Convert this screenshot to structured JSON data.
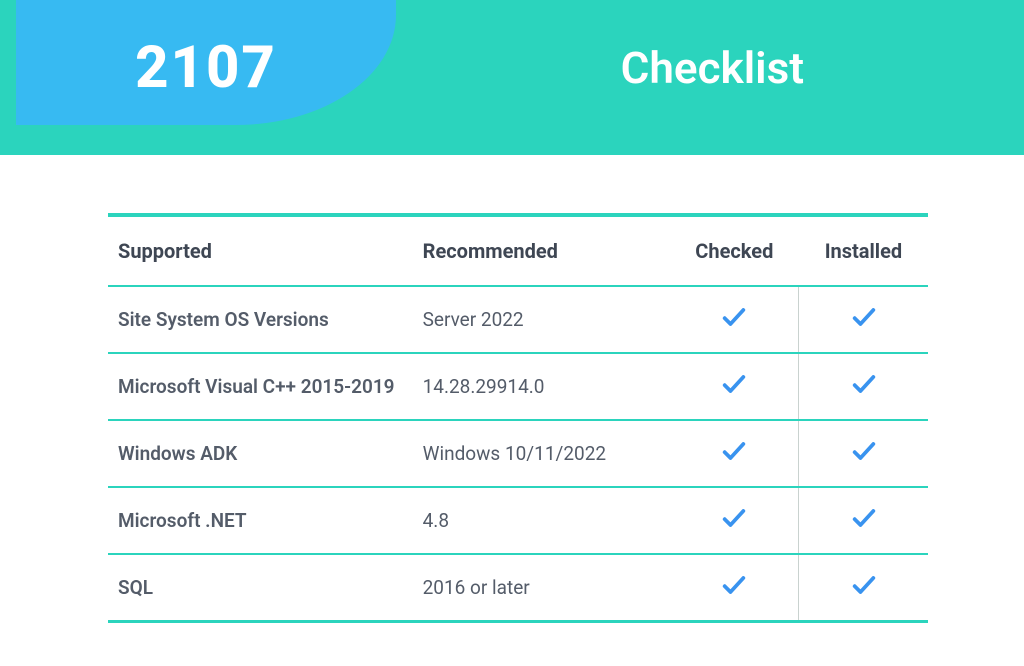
{
  "header": {
    "badge": "2107",
    "title": "Checklist"
  },
  "columns": {
    "supported": "Supported",
    "recommended": "Recommended",
    "checked": "Checked",
    "installed": "Installed"
  },
  "rows": [
    {
      "supported": "Site System OS Versions",
      "recommended": "Server 2022",
      "checked": true,
      "installed": true
    },
    {
      "supported": "Microsoft Visual C++ 2015-2019",
      "recommended": "14.28.29914.0",
      "checked": true,
      "installed": true
    },
    {
      "supported": "Windows ADK",
      "recommended": "Windows 10/11/2022",
      "checked": true,
      "installed": true
    },
    {
      "supported": "Microsoft .NET",
      "recommended": "4.8",
      "checked": true,
      "installed": true
    },
    {
      "supported": "SQL",
      "recommended": "2016 or later",
      "checked": true,
      "installed": true
    }
  ],
  "icons": {
    "checkmark": "checkmark-icon"
  },
  "colors": {
    "teal": "#2bd4bd",
    "blue": "#37baf2",
    "checkmark": "#3993ef"
  }
}
